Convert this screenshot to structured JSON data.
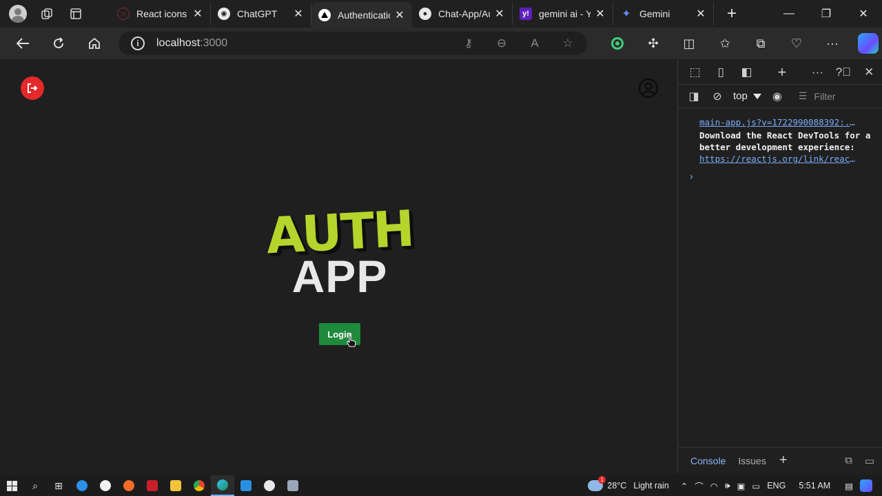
{
  "browser": {
    "tabs": [
      {
        "title": "React icons",
        "favicon": "react-icon",
        "active": false
      },
      {
        "title": "ChatGPT",
        "favicon": "chatgpt-icon",
        "active": false
      },
      {
        "title": "Authentication",
        "favicon": "vercel-triangle-icon",
        "active": true
      },
      {
        "title": "Chat-App/Auth",
        "favicon": "github-icon",
        "active": false
      },
      {
        "title": "gemini ai - Yahoo",
        "favicon": "yahoo-icon",
        "active": false
      },
      {
        "title": "Gemini",
        "favicon": "gemini-icon",
        "active": false
      }
    ],
    "url_host": "localhost",
    "url_port": ":3000"
  },
  "page": {
    "logo_line1": "AUTH",
    "logo_line2": "APP",
    "login_label": "Login",
    "colors": {
      "logo_green": "#b5d42c",
      "login_green": "#1f8a3c",
      "logout_red": "#e5282a"
    }
  },
  "devtools": {
    "context": "top",
    "filter_placeholder": "Filter",
    "console_source": "main-app.js?v=1722990088392:...",
    "console_message": "Download the React DevTools for a better development experience:",
    "console_link": "https://reactjs.org/link/react-devtools",
    "bottom_tabs": [
      "Console",
      "Issues"
    ]
  },
  "taskbar": {
    "temperature": "28°C",
    "weather": "Light rain",
    "language": "ENG",
    "time": "5:51 AM"
  }
}
